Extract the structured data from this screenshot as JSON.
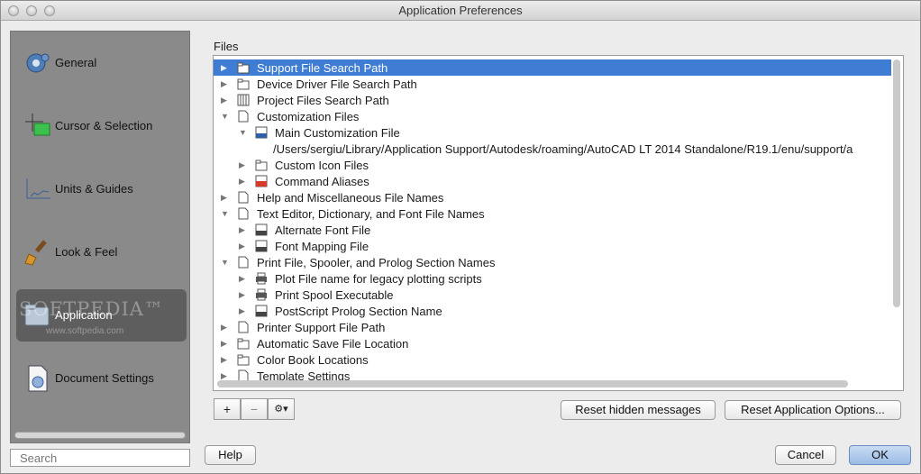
{
  "window": {
    "title": "Application Preferences"
  },
  "sidebar": {
    "items": [
      {
        "label": "General",
        "icon": "gear-icon"
      },
      {
        "label": "Cursor & Selection",
        "icon": "cursor-selection-icon"
      },
      {
        "label": "Units & Guides",
        "icon": "units-guides-icon"
      },
      {
        "label": "Look & Feel",
        "icon": "brush-icon"
      },
      {
        "label": "Application",
        "icon": "application-folder-icon",
        "selected": true
      },
      {
        "label": "Document Settings",
        "icon": "document-settings-icon"
      }
    ],
    "watermark": "SOFTPEDIA™",
    "watermark_url": "www.softpedia.com",
    "search_placeholder": "Search"
  },
  "files": {
    "label": "Files",
    "rows": [
      {
        "label": "Support File Search Path",
        "level": 0,
        "expanded": false,
        "icon": "folder-icon",
        "selected": true
      },
      {
        "label": "Device Driver File Search Path",
        "level": 0,
        "expanded": false,
        "icon": "folder-icon"
      },
      {
        "label": "Project Files Search Path",
        "level": 0,
        "expanded": false,
        "icon": "project-files-icon"
      },
      {
        "label": "Customization Files",
        "level": 0,
        "expanded": true,
        "icon": "document-icon"
      },
      {
        "label": "Main Customization File",
        "level": 1,
        "expanded": true,
        "icon": "cui-file-icon"
      },
      {
        "label": "/Users/sergiu/Library/Application Support/Autodesk/roaming/AutoCAD LT 2014 Standalone/R19.1/enu/support/a",
        "level": 2,
        "expanded": null,
        "icon": ""
      },
      {
        "label": "Custom Icon Files",
        "level": 1,
        "expanded": false,
        "icon": "folder-icon"
      },
      {
        "label": "Command Aliases",
        "level": 1,
        "expanded": false,
        "icon": "pgp-file-icon"
      },
      {
        "label": "Help and Miscellaneous File Names",
        "level": 0,
        "expanded": false,
        "icon": "document-icon"
      },
      {
        "label": "Text Editor, Dictionary, and Font File Names",
        "level": 0,
        "expanded": true,
        "icon": "document-icon"
      },
      {
        "label": "Alternate Font File",
        "level": 1,
        "expanded": false,
        "icon": "ttf-file-icon"
      },
      {
        "label": "Font Mapping File",
        "level": 1,
        "expanded": false,
        "icon": "fmp-file-icon"
      },
      {
        "label": "Print File, Spooler, and Prolog Section Names",
        "level": 0,
        "expanded": true,
        "icon": "document-icon"
      },
      {
        "label": "Plot File name for legacy plotting scripts",
        "level": 1,
        "expanded": false,
        "icon": "printer-icon"
      },
      {
        "label": "Print Spool Executable",
        "level": 1,
        "expanded": false,
        "icon": "printer-icon"
      },
      {
        "label": "PostScript Prolog Section Name",
        "level": 1,
        "expanded": false,
        "icon": "psf-file-icon"
      },
      {
        "label": "Printer Support File Path",
        "level": 0,
        "expanded": false,
        "icon": "document-icon"
      },
      {
        "label": "Automatic Save File Location",
        "level": 0,
        "expanded": false,
        "icon": "folder-icon"
      },
      {
        "label": "Color Book Locations",
        "level": 0,
        "expanded": false,
        "icon": "folder-icon"
      },
      {
        "label": "Template Settings",
        "level": 0,
        "expanded": false,
        "icon": "document-icon"
      }
    ]
  },
  "toolbar": {
    "add": "+",
    "remove": "−",
    "action": "⚙▾"
  },
  "buttons": {
    "reset_hidden": "Reset hidden messages",
    "reset_app": "Reset Application Options...",
    "help": "Help",
    "cancel": "Cancel",
    "ok": "OK"
  },
  "colors": {
    "selection": "#3f7cd4",
    "sidebar_bg": "#8a8a8a",
    "sidebar_selected": "#5e5e5e"
  }
}
